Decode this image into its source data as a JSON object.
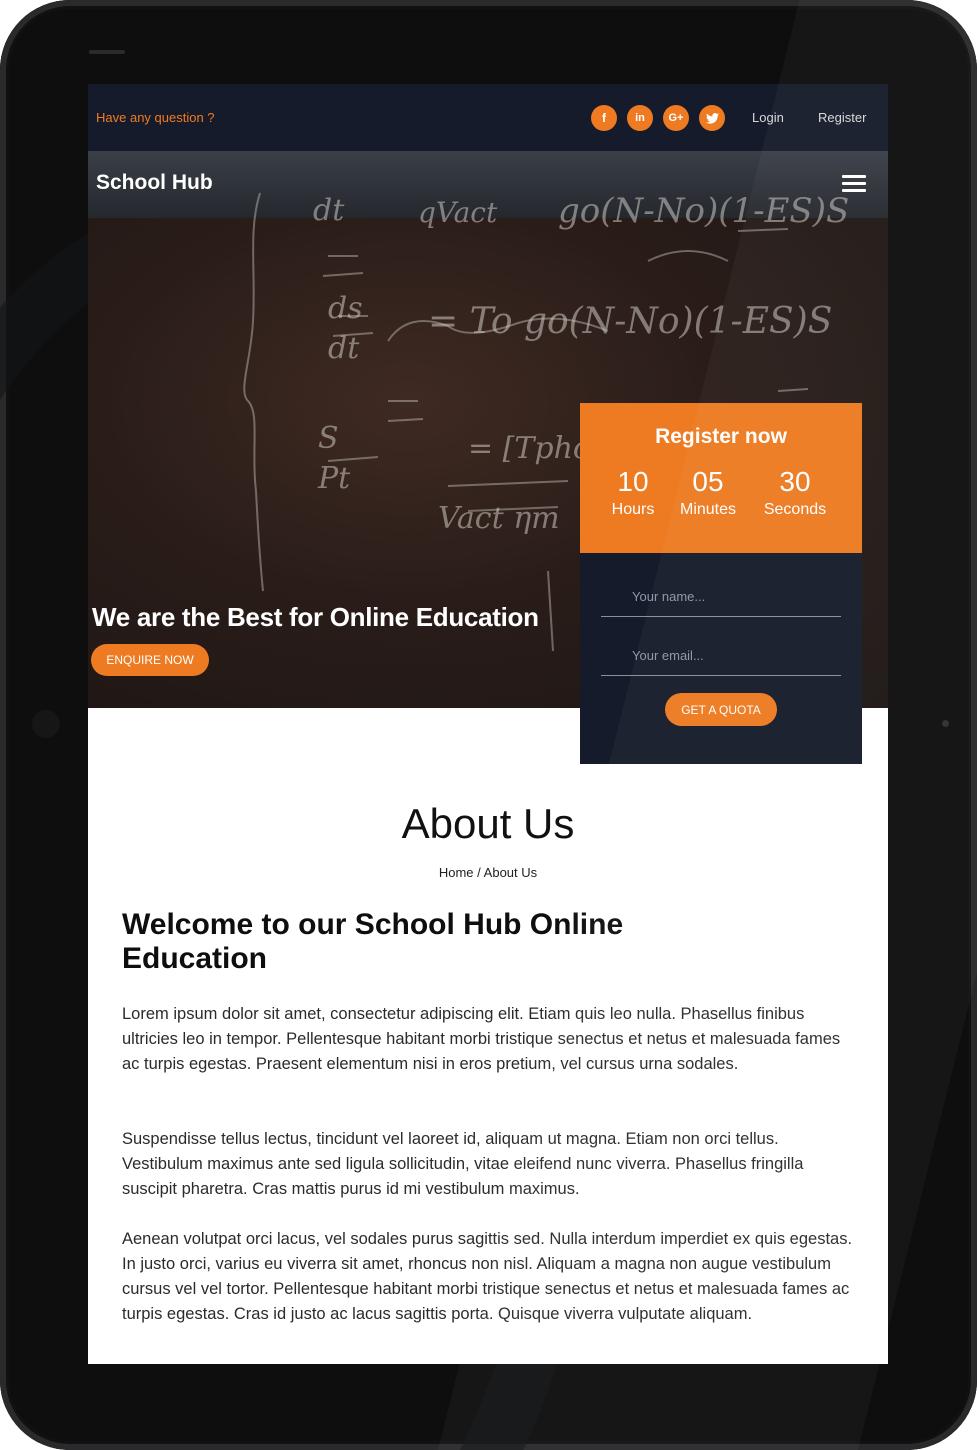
{
  "topbar": {
    "question": "Have any question ?",
    "social": [
      {
        "icon": "facebook-icon",
        "glyph": "f"
      },
      {
        "icon": "linkedin-icon",
        "glyph": "in"
      },
      {
        "icon": "google-plus-icon",
        "glyph": "G+"
      },
      {
        "icon": "twitter-icon",
        "glyph": "t"
      }
    ],
    "login": "Login",
    "register": "Register"
  },
  "nav": {
    "brand": "School Hub",
    "menu_icon": "hamburger-menu-icon"
  },
  "hero": {
    "title": "We are the Best for Online Education",
    "cta": "ENQUIRE NOW"
  },
  "register_card": {
    "title": "Register now",
    "countdown": [
      {
        "value": "10",
        "label": "Hours"
      },
      {
        "value": "05",
        "label": "Minutes"
      },
      {
        "value": "30",
        "label": "Seconds"
      }
    ],
    "name_placeholder": "Your name...",
    "email_placeholder": "Your email...",
    "submit": "GET A QUOTA"
  },
  "about": {
    "title": "About Us",
    "breadcrumb_home": "Home",
    "breadcrumb_sep": "/",
    "breadcrumb_current": "About Us",
    "heading": "Welcome to our School Hub Online Education",
    "paragraphs": [
      "Lorem ipsum dolor sit amet, consectetur adipiscing elit. Etiam quis leo nulla. Phasellus finibus ultricies leo in tempor. Pellentesque habitant morbi tristique senectus et netus et malesuada fames ac turpis egestas. Praesent elementum nisi in eros pretium, vel cursus urna sodales.",
      "Suspendisse tellus lectus, tincidunt vel laoreet id, aliquam ut magna. Etiam non orci tellus. Vestibulum maximus ante sed ligula sollicitudin, vitae eleifend nunc viverra. Phasellus fringilla suscipit pharetra. Cras mattis purus id mi vestibulum maximus.",
      "Aenean volutpat orci lacus, vel sodales purus sagittis sed. Nulla interdum imperdiet ex quis egestas. In justo orci, varius eu viverra sit amet, rhoncus non nisl. Aliquam a magna non augue vestibulum cursus vel vel tortor. Pellentesque habitant morbi tristique senectus et netus et malesuada fames ac turpis egestas. Cras id justo ac lacus sagittis porta. Quisque viverra vulputate aliquam."
    ]
  },
  "colors": {
    "accent": "#ee7b22",
    "navy": "#161b2b"
  }
}
